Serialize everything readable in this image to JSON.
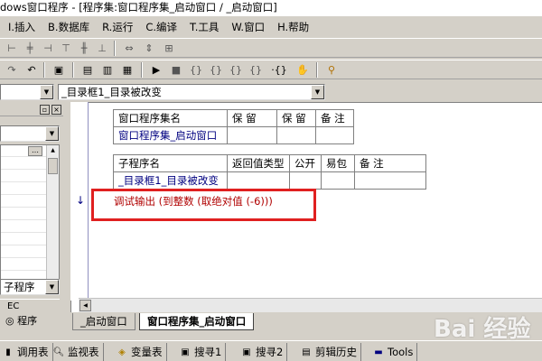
{
  "window": {
    "title": "dows窗口程序 - [程序集:窗口程序集_启动窗口 / _启动窗口]"
  },
  "menu": [
    "I.插入",
    "B.数据库",
    "R.运行",
    "C.编译",
    "T.工具",
    "W.窗口",
    "H.帮助"
  ],
  "toolbar": {
    "object_combo": "",
    "event_combo": "_目录框1_目录被改变"
  },
  "left_panel": {
    "tabs": [
      {
        "label": "EC"
      },
      {
        "label": "程序"
      }
    ],
    "program_label": "子程序"
  },
  "editor": {
    "assembly_table": {
      "headers": [
        "窗口程序集名",
        "保 留",
        "保 留",
        "备 注"
      ],
      "row": [
        "窗口程序集_启动窗口",
        "",
        "",
        ""
      ]
    },
    "sub_table": {
      "headers": [
        "子程序名",
        "返回值类型",
        "公开",
        "易包",
        "备 注"
      ],
      "row": [
        "_目录框1_目录被改变",
        "",
        "",
        "",
        ""
      ]
    },
    "code_line": "调试输出 (到整数 (取绝对值 (-6)))",
    "arrow": "↓"
  },
  "tabs": [
    {
      "label": "_启动窗口",
      "active": false
    },
    {
      "label": "窗口程序集_启动窗口",
      "active": true
    }
  ],
  "bottom_tabs": [
    {
      "label": "调用表",
      "icon": "call-table-icon"
    },
    {
      "label": "监视表",
      "icon": "magnifier-icon"
    },
    {
      "label": "变量表",
      "icon": "variable-icon"
    },
    {
      "label": "搜寻1",
      "icon": "search-1-icon"
    },
    {
      "label": "搜寻2",
      "icon": "search-2-icon"
    },
    {
      "label": "剪辑历史",
      "icon": "clipboard-icon"
    },
    {
      "label": "Tools",
      "icon": "tools-icon"
    }
  ],
  "watermark": "Bai 经验"
}
